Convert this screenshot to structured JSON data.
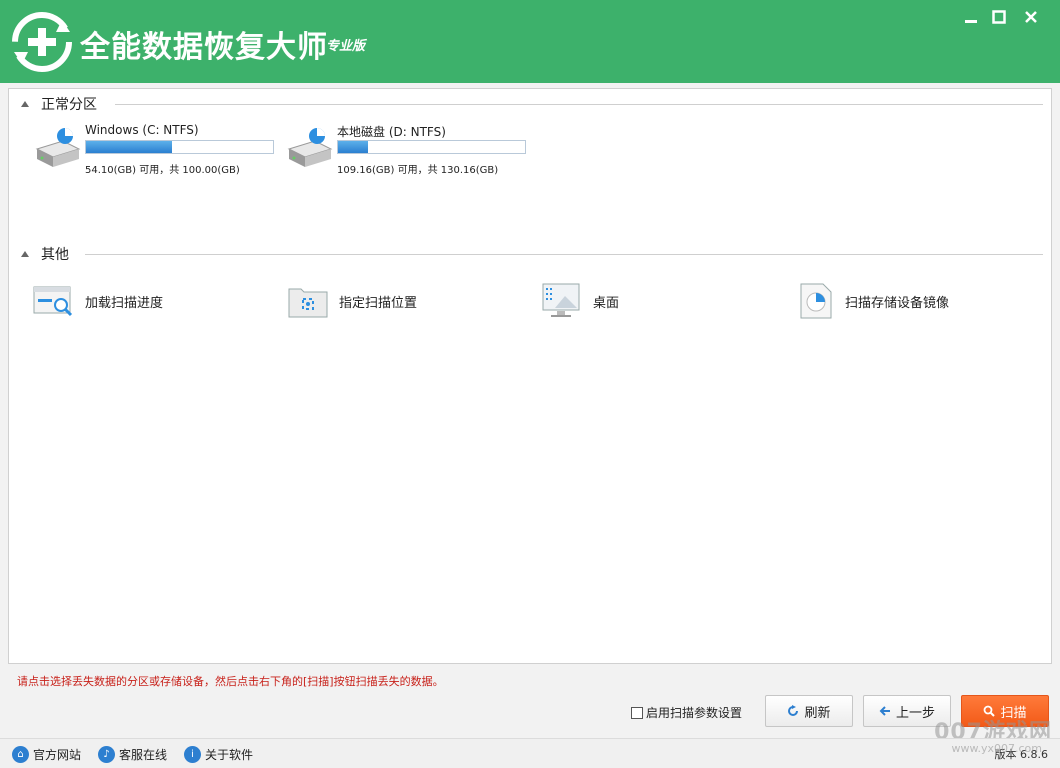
{
  "app": {
    "title": "全能数据恢复大师",
    "edition": "专业版"
  },
  "window_controls": {
    "minimize": "minimize-icon",
    "maximize": "maximize-icon",
    "close": "close-icon"
  },
  "sections": {
    "partitions": {
      "title": "正常分区"
    },
    "other": {
      "title": "其他"
    }
  },
  "drives": [
    {
      "label": "Windows (C: NTFS)",
      "used_fraction": 0.459,
      "size_text": "54.10(GB) 可用，共 100.00(GB)"
    },
    {
      "label": "本地磁盘 (D: NTFS)",
      "used_fraction": 0.161,
      "size_text": "109.16(GB) 可用，共 130.16(GB)"
    }
  ],
  "other_items": [
    {
      "label": "加载扫描进度",
      "icon": "load-progress-icon"
    },
    {
      "label": "指定扫描位置",
      "icon": "folder-target-icon"
    },
    {
      "label": "桌面",
      "icon": "desktop-icon"
    },
    {
      "label": "扫描存储设备镜像",
      "icon": "disk-image-icon"
    }
  ],
  "hint": "请点击选择丢失数据的分区或存储设备，然后点击右下角的[扫描]按钮扫描丢失的数据。",
  "options": {
    "enable_scan_params": "启用扫描参数设置",
    "checked": false
  },
  "buttons": {
    "refresh": "刷新",
    "prev": "上一步",
    "scan": "扫描"
  },
  "statusbar": {
    "website": "官方网站",
    "service": "客服在线",
    "about": "关于软件",
    "version": "版本 6.8.6"
  },
  "watermark": {
    "main": "007游戏网",
    "sub": "www.yx007.com"
  },
  "colors": {
    "titlebar": "#3db16b",
    "scan_button": "#f25a18",
    "hint_text": "#c8221b",
    "progress": "#2b7fd0"
  }
}
